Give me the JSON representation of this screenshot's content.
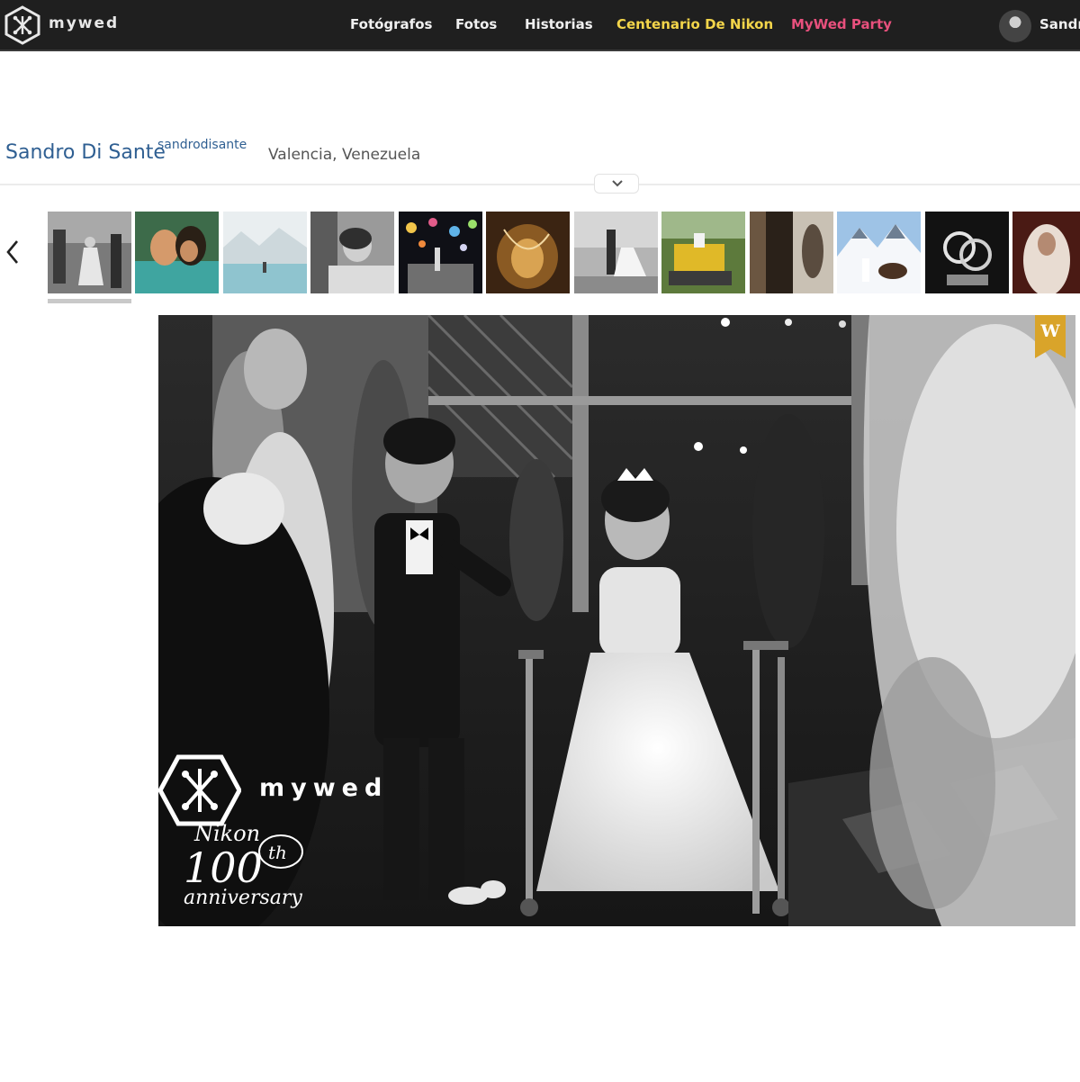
{
  "brand": {
    "name": "mywed"
  },
  "nav": {
    "items": [
      {
        "label": "Fotógrafos",
        "color": "#f0f0f0"
      },
      {
        "label": "Fotos",
        "color": "#f0f0f0"
      },
      {
        "label": "Historias",
        "color": "#f0f0f0"
      },
      {
        "label": "Centenario De Nikon",
        "color": "#f3d54a"
      },
      {
        "label": "MyWed Party",
        "color": "#e8507d"
      }
    ],
    "user": {
      "name": "Sandr"
    }
  },
  "profile": {
    "name": "Sandro Di Sante",
    "handle": "sandrodisante",
    "location": "Valencia, Venezuela"
  },
  "gallery": {
    "thumbnails": [
      "bw-ceremony-children",
      "couple-embrace-pool",
      "snowy-lake-couple",
      "bw-couple-closeup",
      "night-party-lanterns",
      "golden-veil-detail",
      "bw-couple-park",
      "bride-on-bulldozer",
      "bride-at-window",
      "snowy-mountain-horse",
      "rings-sculpture",
      "bride-veil-portrait"
    ]
  },
  "photo": {
    "badge_letter": "W",
    "badge_color": "#d9a42a",
    "watermark": {
      "brand": "mywed",
      "nikon_text": "Nikon",
      "anniversary_number": "100",
      "anniversary_suffix": "th",
      "anniversary_word": "anniversary"
    }
  }
}
